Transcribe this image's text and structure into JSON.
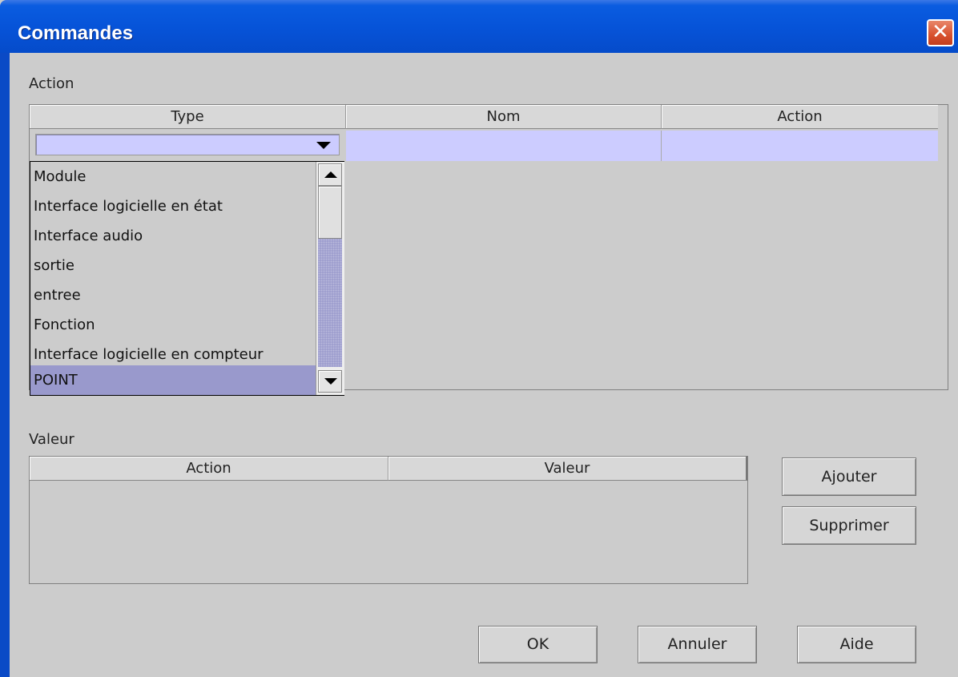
{
  "window": {
    "title": "Commandes",
    "close_label": "✕"
  },
  "action_section": {
    "label": "Action",
    "columns": [
      "Type",
      "Nom",
      "Action"
    ],
    "type_combo_value": "",
    "dropdown": {
      "items": [
        "Module",
        "Interface logicielle en état",
        "Interface audio",
        "sortie",
        "entree",
        "Fonction",
        "Interface logicielle en compteur",
        "POINT"
      ],
      "selected_index": 7
    }
  },
  "value_section": {
    "label": "Valeur",
    "columns": [
      "Action",
      "Valeur"
    ],
    "rows": []
  },
  "side_buttons": {
    "add": "Ajouter",
    "remove": "Supprimer"
  },
  "footer_buttons": {
    "ok": "OK",
    "cancel": "Annuler",
    "help": "Aide"
  },
  "colors": {
    "title_bar": "#0653d8",
    "selection": "#9999cc",
    "row_highlight": "#ccccff",
    "close_button": "#d8512e"
  }
}
